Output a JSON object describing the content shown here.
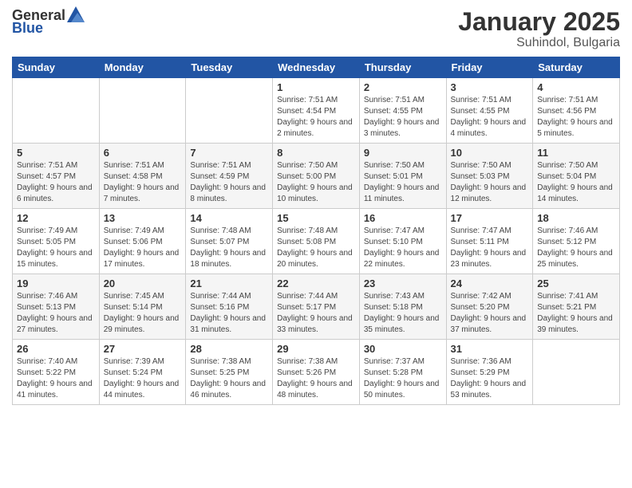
{
  "header": {
    "logo_general": "General",
    "logo_blue": "Blue",
    "month_title": "January 2025",
    "location": "Suhindol, Bulgaria"
  },
  "weekdays": [
    "Sunday",
    "Monday",
    "Tuesday",
    "Wednesday",
    "Thursday",
    "Friday",
    "Saturday"
  ],
  "weeks": [
    [
      {
        "day": "",
        "info": ""
      },
      {
        "day": "",
        "info": ""
      },
      {
        "day": "",
        "info": ""
      },
      {
        "day": "1",
        "info": "Sunrise: 7:51 AM\nSunset: 4:54 PM\nDaylight: 9 hours and 2 minutes."
      },
      {
        "day": "2",
        "info": "Sunrise: 7:51 AM\nSunset: 4:55 PM\nDaylight: 9 hours and 3 minutes."
      },
      {
        "day": "3",
        "info": "Sunrise: 7:51 AM\nSunset: 4:55 PM\nDaylight: 9 hours and 4 minutes."
      },
      {
        "day": "4",
        "info": "Sunrise: 7:51 AM\nSunset: 4:56 PM\nDaylight: 9 hours and 5 minutes."
      }
    ],
    [
      {
        "day": "5",
        "info": "Sunrise: 7:51 AM\nSunset: 4:57 PM\nDaylight: 9 hours and 6 minutes."
      },
      {
        "day": "6",
        "info": "Sunrise: 7:51 AM\nSunset: 4:58 PM\nDaylight: 9 hours and 7 minutes."
      },
      {
        "day": "7",
        "info": "Sunrise: 7:51 AM\nSunset: 4:59 PM\nDaylight: 9 hours and 8 minutes."
      },
      {
        "day": "8",
        "info": "Sunrise: 7:50 AM\nSunset: 5:00 PM\nDaylight: 9 hours and 10 minutes."
      },
      {
        "day": "9",
        "info": "Sunrise: 7:50 AM\nSunset: 5:01 PM\nDaylight: 9 hours and 11 minutes."
      },
      {
        "day": "10",
        "info": "Sunrise: 7:50 AM\nSunset: 5:03 PM\nDaylight: 9 hours and 12 minutes."
      },
      {
        "day": "11",
        "info": "Sunrise: 7:50 AM\nSunset: 5:04 PM\nDaylight: 9 hours and 14 minutes."
      }
    ],
    [
      {
        "day": "12",
        "info": "Sunrise: 7:49 AM\nSunset: 5:05 PM\nDaylight: 9 hours and 15 minutes."
      },
      {
        "day": "13",
        "info": "Sunrise: 7:49 AM\nSunset: 5:06 PM\nDaylight: 9 hours and 17 minutes."
      },
      {
        "day": "14",
        "info": "Sunrise: 7:48 AM\nSunset: 5:07 PM\nDaylight: 9 hours and 18 minutes."
      },
      {
        "day": "15",
        "info": "Sunrise: 7:48 AM\nSunset: 5:08 PM\nDaylight: 9 hours and 20 minutes."
      },
      {
        "day": "16",
        "info": "Sunrise: 7:47 AM\nSunset: 5:10 PM\nDaylight: 9 hours and 22 minutes."
      },
      {
        "day": "17",
        "info": "Sunrise: 7:47 AM\nSunset: 5:11 PM\nDaylight: 9 hours and 23 minutes."
      },
      {
        "day": "18",
        "info": "Sunrise: 7:46 AM\nSunset: 5:12 PM\nDaylight: 9 hours and 25 minutes."
      }
    ],
    [
      {
        "day": "19",
        "info": "Sunrise: 7:46 AM\nSunset: 5:13 PM\nDaylight: 9 hours and 27 minutes."
      },
      {
        "day": "20",
        "info": "Sunrise: 7:45 AM\nSunset: 5:14 PM\nDaylight: 9 hours and 29 minutes."
      },
      {
        "day": "21",
        "info": "Sunrise: 7:44 AM\nSunset: 5:16 PM\nDaylight: 9 hours and 31 minutes."
      },
      {
        "day": "22",
        "info": "Sunrise: 7:44 AM\nSunset: 5:17 PM\nDaylight: 9 hours and 33 minutes."
      },
      {
        "day": "23",
        "info": "Sunrise: 7:43 AM\nSunset: 5:18 PM\nDaylight: 9 hours and 35 minutes."
      },
      {
        "day": "24",
        "info": "Sunrise: 7:42 AM\nSunset: 5:20 PM\nDaylight: 9 hours and 37 minutes."
      },
      {
        "day": "25",
        "info": "Sunrise: 7:41 AM\nSunset: 5:21 PM\nDaylight: 9 hours and 39 minutes."
      }
    ],
    [
      {
        "day": "26",
        "info": "Sunrise: 7:40 AM\nSunset: 5:22 PM\nDaylight: 9 hours and 41 minutes."
      },
      {
        "day": "27",
        "info": "Sunrise: 7:39 AM\nSunset: 5:24 PM\nDaylight: 9 hours and 44 minutes."
      },
      {
        "day": "28",
        "info": "Sunrise: 7:38 AM\nSunset: 5:25 PM\nDaylight: 9 hours and 46 minutes."
      },
      {
        "day": "29",
        "info": "Sunrise: 7:38 AM\nSunset: 5:26 PM\nDaylight: 9 hours and 48 minutes."
      },
      {
        "day": "30",
        "info": "Sunrise: 7:37 AM\nSunset: 5:28 PM\nDaylight: 9 hours and 50 minutes."
      },
      {
        "day": "31",
        "info": "Sunrise: 7:36 AM\nSunset: 5:29 PM\nDaylight: 9 hours and 53 minutes."
      },
      {
        "day": "",
        "info": ""
      }
    ]
  ]
}
